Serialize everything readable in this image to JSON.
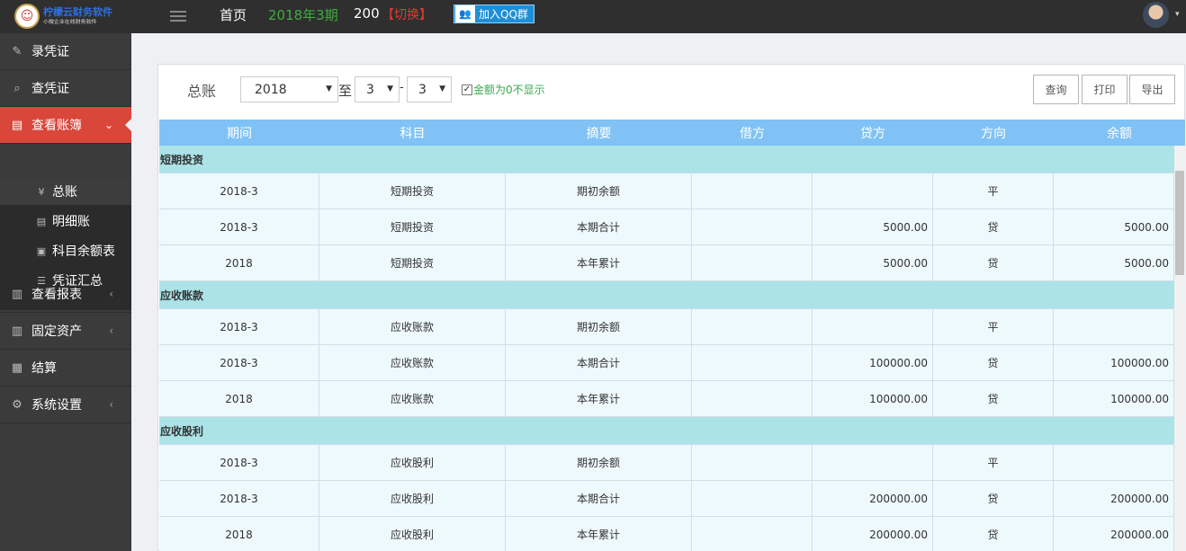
{
  "header": {
    "logo_title": "柠檬云财务软件",
    "logo_subtitle": "小微企业在线财务软件",
    "logo_mark": "☺",
    "nav_home": "首页",
    "nav_period": "2018年3期",
    "nav_number": "200",
    "nav_switch": "【切换】",
    "qq_icon": "👥",
    "qq_button": "加入QQ群",
    "avatar_caret": "▾"
  },
  "sidebar": {
    "items": [
      {
        "label": "录凭证",
        "icon": "✎",
        "arrow": ""
      },
      {
        "label": "查凭证",
        "icon": "⌕",
        "arrow": ""
      },
      {
        "label": "查看账簿",
        "icon": "▤",
        "arrow": "⌄"
      },
      {
        "label": "查看报表",
        "icon": "▥",
        "arrow": "‹"
      },
      {
        "label": "固定资产",
        "icon": "▥",
        "arrow": "‹"
      },
      {
        "label": "结算",
        "icon": "▦",
        "arrow": ""
      },
      {
        "label": "系统设置",
        "icon": "⚙",
        "arrow": "‹"
      }
    ],
    "sub_items": [
      {
        "label": "总账",
        "icon": "¥"
      },
      {
        "label": "明细账",
        "icon": "▤"
      },
      {
        "label": "科目余额表",
        "icon": "▣"
      },
      {
        "label": "凭证汇总",
        "icon": "☰"
      }
    ]
  },
  "toolbar": {
    "title": "总账",
    "year": "2018",
    "to_label": "至",
    "month_from": "3",
    "dash": "-",
    "month_to": "3",
    "caret": "▼",
    "checkbox_mark": "✓",
    "checkbox_label": "金额为0不显示",
    "query_button": "查询",
    "print_button": "打印",
    "export_button": "导出"
  },
  "table": {
    "columns": [
      "期间",
      "科目",
      "摘要",
      "借方",
      "贷方",
      "方向",
      "余额"
    ],
    "groups": [
      {
        "name": "短期投资",
        "rows": [
          [
            "2018-3",
            "短期投资",
            "期初余额",
            "",
            "",
            "平",
            ""
          ],
          [
            "2018-3",
            "短期投资",
            "本期合计",
            "",
            "5000.00",
            "贷",
            "5000.00"
          ],
          [
            "2018",
            "短期投资",
            "本年累计",
            "",
            "5000.00",
            "贷",
            "5000.00"
          ]
        ]
      },
      {
        "name": "应收账款",
        "rows": [
          [
            "2018-3",
            "应收账款",
            "期初余额",
            "",
            "",
            "平",
            ""
          ],
          [
            "2018-3",
            "应收账款",
            "本期合计",
            "",
            "100000.00",
            "贷",
            "100000.00"
          ],
          [
            "2018",
            "应收账款",
            "本年累计",
            "",
            "100000.00",
            "贷",
            "100000.00"
          ]
        ]
      },
      {
        "name": "应收股利",
        "rows": [
          [
            "2018-3",
            "应收股利",
            "期初余额",
            "",
            "",
            "平",
            ""
          ],
          [
            "2018-3",
            "应收股利",
            "本期合计",
            "",
            "200000.00",
            "贷",
            "200000.00"
          ],
          [
            "2018",
            "应收股利",
            "本年累计",
            "",
            "200000.00",
            "贷",
            "200000.00"
          ]
        ]
      }
    ]
  }
}
